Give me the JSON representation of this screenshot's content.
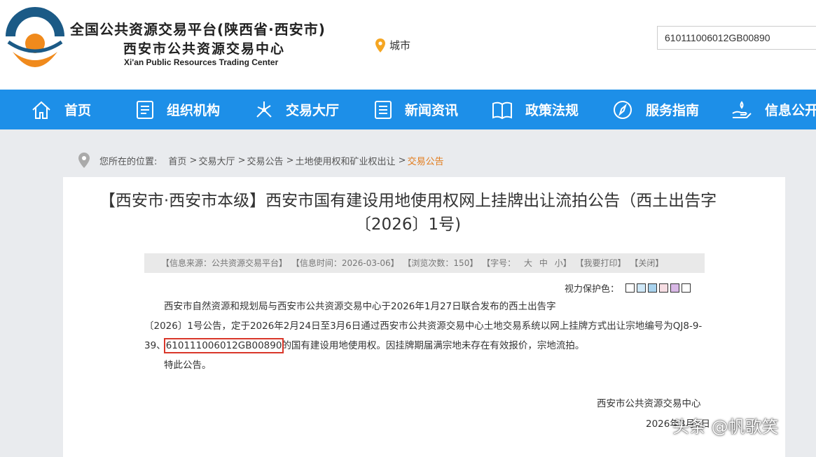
{
  "header": {
    "title": "全国公共资源交易平台(陕西省·西安市)",
    "subtitle": "西安市公共资源交易中心",
    "english_name": "Xi'an Public Resources Trading Center",
    "city_label": "城市",
    "search_value": "610111006012GB00890"
  },
  "nav": {
    "items": [
      {
        "label": "首页",
        "icon": "home-icon"
      },
      {
        "label": "组织机构",
        "icon": "document-icon"
      },
      {
        "label": "交易大厅",
        "icon": "network-icon"
      },
      {
        "label": "新闻资讯",
        "icon": "list-icon"
      },
      {
        "label": "政策法规",
        "icon": "book-icon"
      },
      {
        "label": "服务指南",
        "icon": "compass-icon"
      },
      {
        "label": "信息公开",
        "icon": "hand-icon"
      }
    ]
  },
  "breadcrumb": {
    "prefix": "您所在的位置:",
    "items": [
      "首页",
      "交易大厅",
      "交易公告",
      "土地使用权和矿业权出让",
      "交易公告"
    ]
  },
  "article": {
    "title": "【西安市·西安市本级】西安市国有建设用地使用权网上挂牌出让流拍公告（西土出告字〔2026〕1号)",
    "info": {
      "source": "【信息来源：公共资源交易平台】",
      "time": "【信息时间：2026-03-06】",
      "views": "【浏览次数：150】",
      "font_label": "【字号：",
      "font_large": "大",
      "font_medium": "中",
      "font_small": "小】",
      "print": "【我要打印】",
      "close": "【关闭】"
    },
    "vision_label": "视力保护色：",
    "vision_colors": [
      "#ffffff",
      "#cfe8f8",
      "#a9d3ee",
      "#f6dde3",
      "#d9b8e6",
      "#ffffff"
    ],
    "para_1": "西安市自然资源和规划局与西安市公共资源交易中心于2026年1月27日联合发布的西土出告字",
    "para_2": "〔2026〕1号公告，定于2026年2月24日至3月6日通过西安市公共资源交易中心土地交易系统以网上挂牌方式出让宗地编号为QJ8-9-",
    "para_3_pre": "39、",
    "para_3_code": "610111006012GB00890",
    "para_3_post": "的国有建设用地使用权。因挂牌期届满宗地未存在有效报价，宗地流拍。",
    "para_4": "特此公告。",
    "sign_org": "西安市公共资源交易中心",
    "sign_date": "2026年3月6日"
  },
  "watermark": "头条 @帆歌笑",
  "colors": {
    "nav_bg": "#1d8fe8",
    "accent": "#e27b1b",
    "logo_blue": "#1b5a86",
    "highlight": "#d9372a"
  }
}
